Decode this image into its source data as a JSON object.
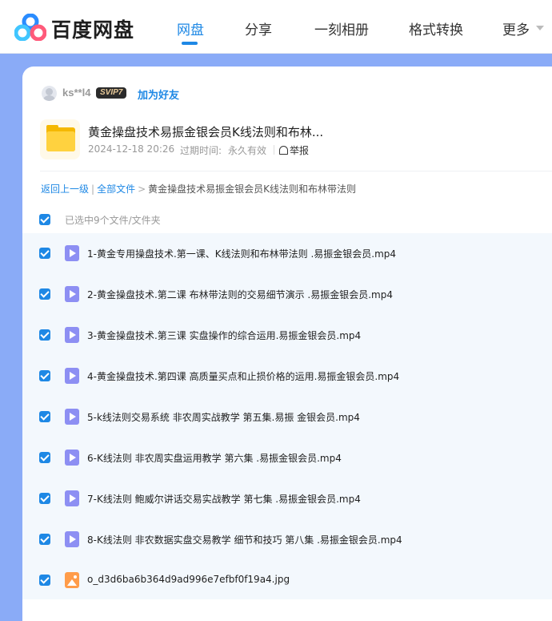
{
  "header": {
    "logo_text": "百度网盘",
    "nav": [
      {
        "label": "网盘",
        "active": true
      },
      {
        "label": "分享",
        "active": false
      },
      {
        "label": "一刻相册",
        "active": false
      },
      {
        "label": "格式转换",
        "active": false
      },
      {
        "label": "更多",
        "active": false
      }
    ],
    "colors": {
      "accent": "#1e88e5",
      "page_background": "#8aabf7"
    }
  },
  "share": {
    "username": "ks**l4",
    "vip_badge": "SVIP7",
    "add_friend": "加为好友",
    "title": "黄金操盘技术易振金银会员K线法则和布林...",
    "created_at": "2024-12-18 20:26",
    "expire_label": "过期时间:",
    "expire_value": "永久有效",
    "report": "举报"
  },
  "breadcrumb": {
    "back": "返回上一级",
    "all_files": "全部文件",
    "current": "黄金操盘技术易振金银会员K线法则和布林带法则"
  },
  "selection": {
    "label": "已选中9个文件/文件夹"
  },
  "files": [
    {
      "name": "1-黄金专用操盘技术.第一课、K线法则和布林带法则 .易振金银会员.mp4",
      "type": "video",
      "checked": true
    },
    {
      "name": "2-黄金操盘技术.第二课 布林带法则的交易细节演示 .易振金银会员.mp4",
      "type": "video",
      "checked": true
    },
    {
      "name": "3-黄金操盘技术.第三课 实盘操作的综合运用.易振金银会员.mp4",
      "type": "video",
      "checked": true
    },
    {
      "name": "4-黄金操盘技术.第四课 高质量买点和止损价格的运用.易振金银会员.mp4",
      "type": "video",
      "checked": true
    },
    {
      "name": "5-k线法则交易系统 非农周实战教学 第五集.易振 金银会员.mp4",
      "type": "video",
      "checked": true
    },
    {
      "name": "6-K线法则 非农周实盘运用教学 第六集 .易振金银会员.mp4",
      "type": "video",
      "checked": true
    },
    {
      "name": "7-K线法则 鲍威尔讲话交易实战教学 第七集 .易振金银会员.mp4",
      "type": "video",
      "checked": true
    },
    {
      "name": "8-K线法则 非农数据实盘交易教学 细节和技巧 第八集 .易振金银会员.mp4",
      "type": "video",
      "checked": true
    },
    {
      "name": "o_d3d6ba6b364d9ad996e7efbf0f19a4.jpg",
      "type": "image",
      "checked": true
    }
  ]
}
